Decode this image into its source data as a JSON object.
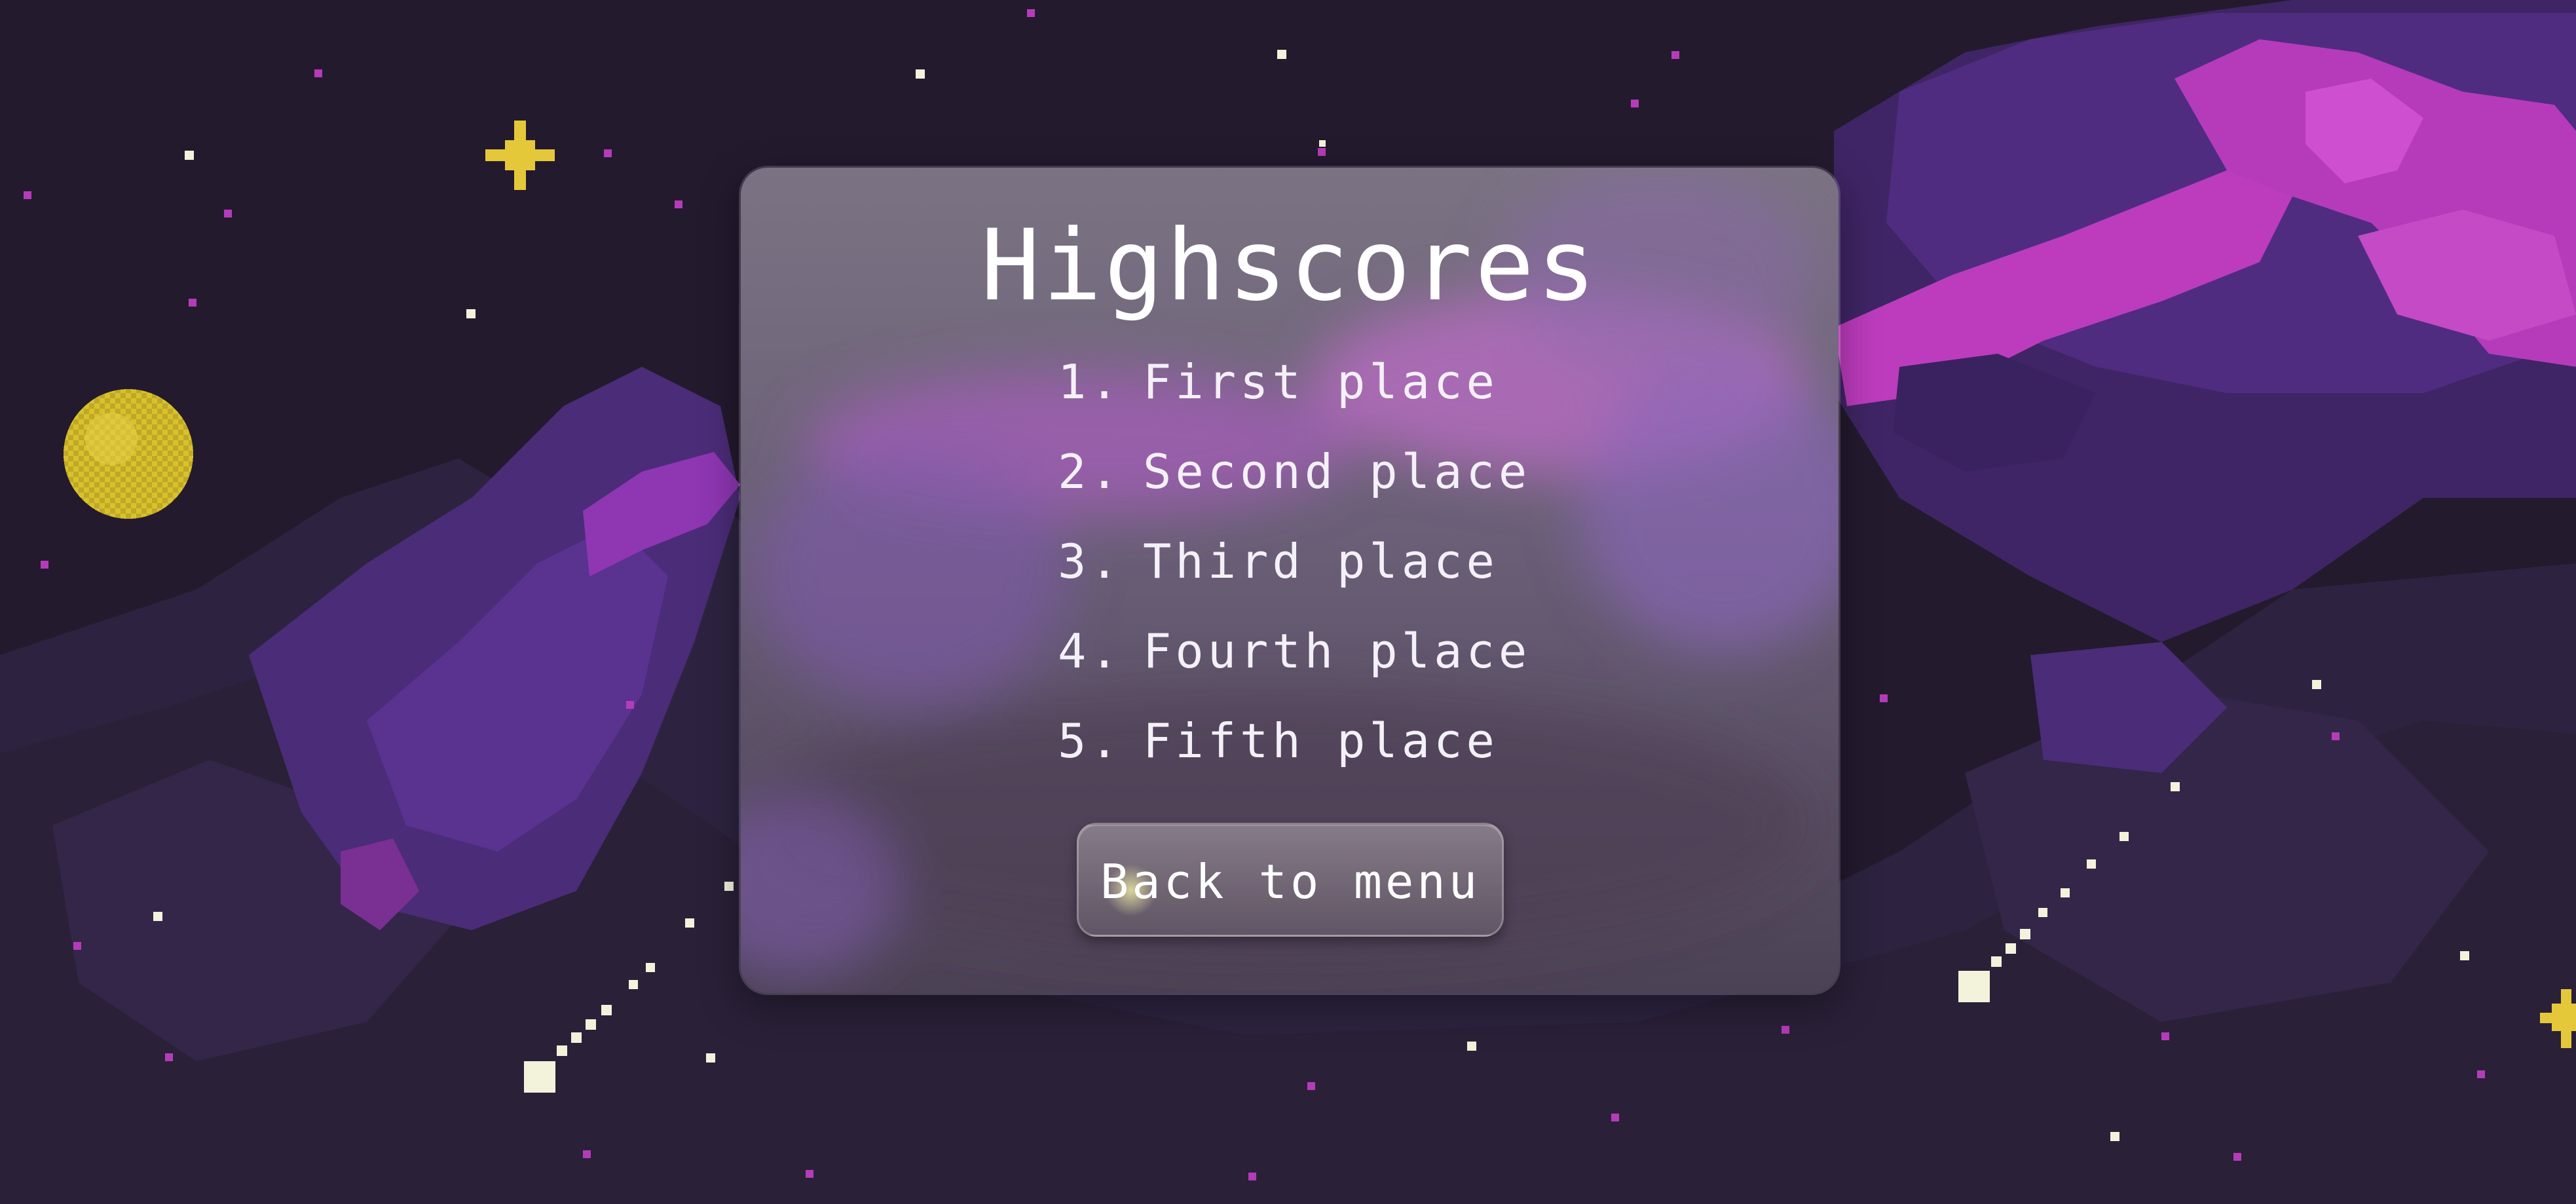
{
  "window": {
    "title": "Highscores"
  },
  "highscores": {
    "entries": [
      {
        "rank": "1.",
        "name": "First place"
      },
      {
        "rank": "2.",
        "name": "Second place"
      },
      {
        "rank": "3.",
        "name": "Third place"
      },
      {
        "rank": "4.",
        "name": "Fourth place"
      },
      {
        "rank": "5.",
        "name": "Fifth place"
      }
    ]
  },
  "actions": {
    "back_label": "Back to menu"
  },
  "colors": {
    "space_background": "#231a2e",
    "nebula_dark": "#2e2340",
    "nebula_mid": "#4a2b78",
    "nebula_pink": "#c046c8",
    "planet_yellow": "#d9c12c",
    "star_yellow": "#e4c83a",
    "star_white": "#f3f3dc",
    "text": "#ffffff"
  },
  "icons": {
    "planet": "planet-icon",
    "sparkle": "sparkle-star-icon",
    "comet": "comet-icon"
  }
}
